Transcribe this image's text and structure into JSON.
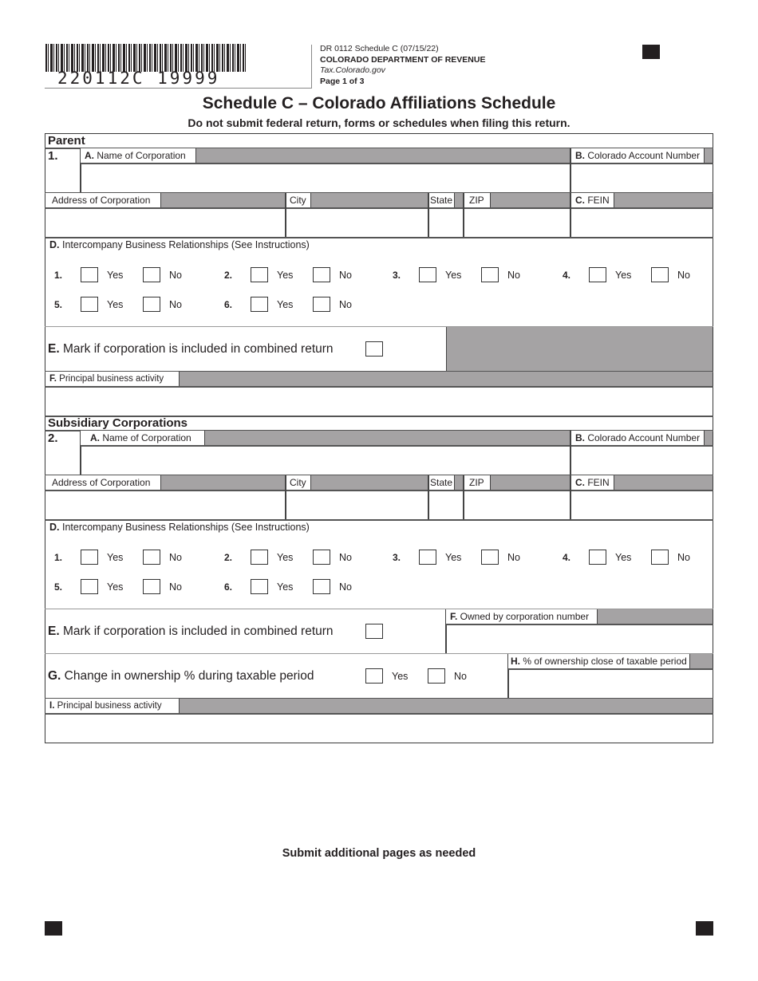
{
  "header": {
    "barcode_number": "220112C 19999",
    "form_id": "DR 0112 Schedule C (07/15/22)",
    "department": "COLORADO DEPARTMENT OF REVENUE",
    "website": "Tax.Colorado.gov",
    "page": "Page 1 of 3"
  },
  "title": "Schedule C – Colorado Affiliations Schedule",
  "subtitle": "Do not submit federal return, forms or schedules when filing this return.",
  "parent": {
    "section_label": "Parent",
    "line_number": "1.",
    "name_label_letter": "A.",
    "name_label": " Name of Corporation",
    "account_label_letter": "B.",
    "account_label": " Colorado Account Number",
    "address_label": "Address of Corporation",
    "city_label": "City",
    "state_label": "State",
    "zip_label": "ZIP",
    "fein_label_letter": "C.",
    "fein_label": " FEIN",
    "relationships_letter": "D.",
    "relationships_label": " Intercompany Business Relationships (See Instructions)",
    "relationships": [
      {
        "num": "1.",
        "yes": "Yes",
        "no": "No"
      },
      {
        "num": "2.",
        "yes": "Yes",
        "no": "No"
      },
      {
        "num": "3.",
        "yes": "Yes",
        "no": "No"
      },
      {
        "num": "4.",
        "yes": "Yes",
        "no": "No"
      },
      {
        "num": "5.",
        "yes": "Yes",
        "no": "No"
      },
      {
        "num": "6.",
        "yes": "Yes",
        "no": "No"
      }
    ],
    "combined_letter": "E.",
    "combined_label": " Mark if corporation is included in combined return",
    "activity_letter": "F.",
    "activity_label": " Principal business activity",
    "values": {
      "name": "",
      "account_number": "",
      "address": "",
      "city": "",
      "state": "",
      "zip": "",
      "fein": "",
      "activity": ""
    }
  },
  "subsidiary": {
    "section_label": "Subsidiary Corporations",
    "line_number": "2.",
    "name_label_letter": "A.",
    "name_label": " Name of Corporation",
    "account_label_letter": "B.",
    "account_label": " Colorado Account Number",
    "address_label": "Address of Corporation",
    "city_label": "City",
    "state_label": "State",
    "zip_label": "ZIP",
    "fein_label_letter": "C.",
    "fein_label": " FEIN",
    "relationships_letter": "D.",
    "relationships_label": " Intercompany Business Relationships (See Instructions)",
    "relationships": [
      {
        "num": "1.",
        "yes": "Yes",
        "no": "No"
      },
      {
        "num": "2.",
        "yes": "Yes",
        "no": "No"
      },
      {
        "num": "3.",
        "yes": "Yes",
        "no": "No"
      },
      {
        "num": "4.",
        "yes": "Yes",
        "no": "No"
      },
      {
        "num": "5.",
        "yes": "Yes",
        "no": "No"
      },
      {
        "num": "6.",
        "yes": "Yes",
        "no": "No"
      }
    ],
    "combined_letter": "E.",
    "combined_label": " Mark if corporation is included in combined return",
    "owned_by_letter": "F.",
    "owned_by_label": " Owned by corporation number",
    "change_letter": "G.",
    "change_label": " Change in ownership % during taxable period",
    "change_yes": "Yes",
    "change_no": "No",
    "pct_letter": "H.",
    "pct_label": " % of ownership close of taxable period",
    "activity_letter": "I.",
    "activity_label": " Principal business activity",
    "values": {
      "name": "",
      "account_number": "",
      "address": "",
      "city": "",
      "state": "",
      "zip": "",
      "fein": "",
      "owned_by": "",
      "pct": "",
      "activity": ""
    }
  },
  "footer_note": "Submit additional pages as needed",
  "colors": {
    "shade": "#a5a3a4",
    "ink": "#231f20"
  }
}
